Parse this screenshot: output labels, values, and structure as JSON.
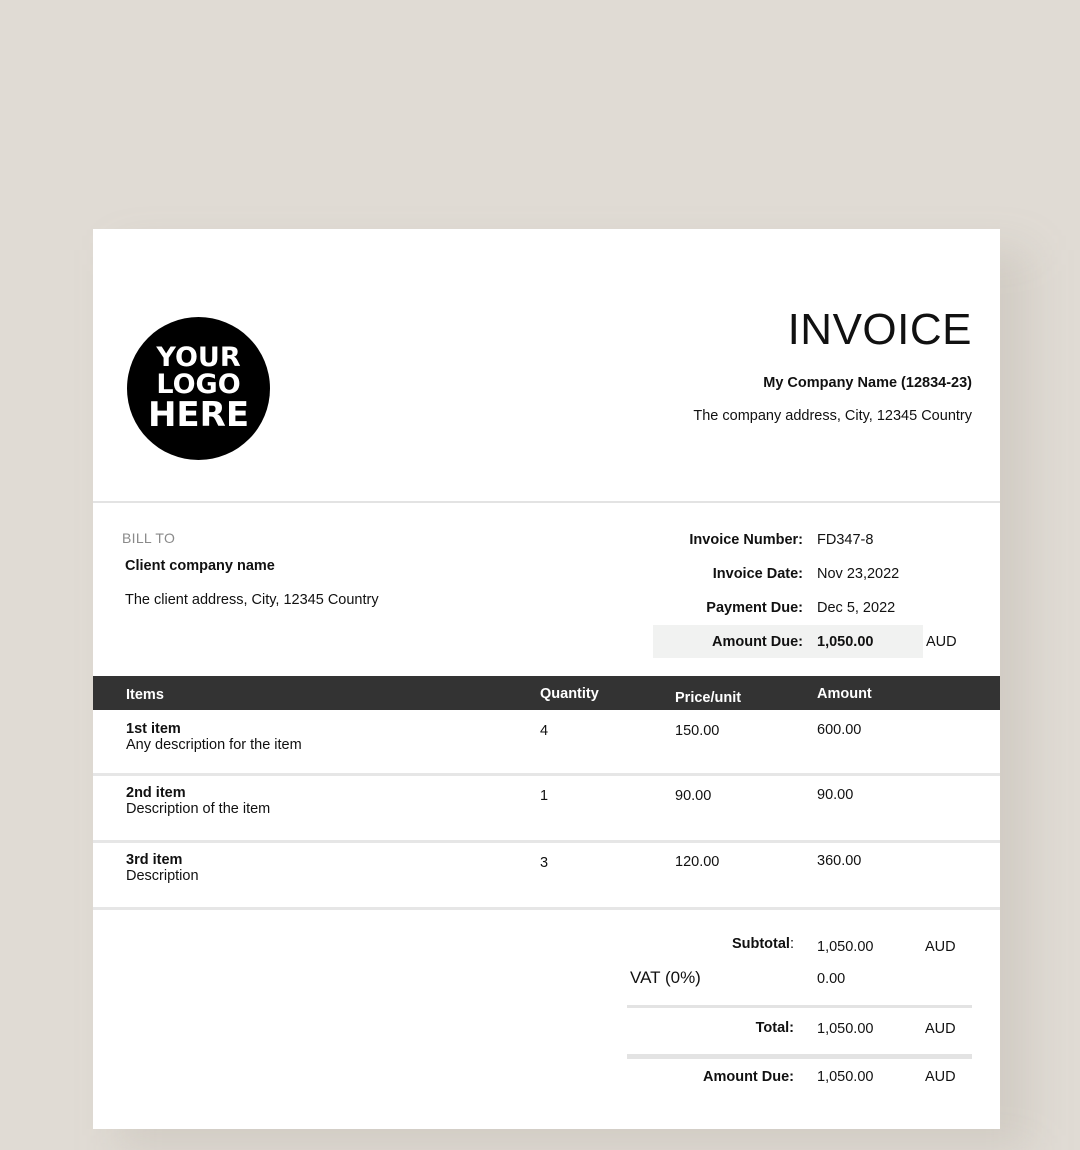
{
  "company": {
    "logo_line1": "YOUR",
    "logo_line2": "LOGO",
    "logo_line3": "HERE",
    "title": "INVOICE",
    "name": "My Company Name (12834-23)",
    "address": "The company address, City, 12345 Country"
  },
  "bill_to": {
    "label": "BILL TO",
    "client_name": "Client company name",
    "client_address": "The client address, City, 12345 Country"
  },
  "meta": {
    "invoice_number_label": "Invoice Number:",
    "invoice_number": "FD347-8",
    "invoice_date_label": "Invoice Date:",
    "invoice_date": "Nov 23,2022",
    "payment_due_label": "Payment Due:",
    "payment_due": "Dec 5, 2022",
    "amount_due_label": "Amount Due:",
    "amount_due": "1,050.00",
    "currency": "AUD"
  },
  "table": {
    "headers": {
      "items": "Items",
      "quantity": "Quantity",
      "price": "Price/unit",
      "amount": "Amount"
    },
    "rows": [
      {
        "name": "1st item",
        "description": "Any description for the item",
        "quantity": "4",
        "price": "150.00",
        "amount": "600.00"
      },
      {
        "name": "2nd item",
        "description": "Description of the item",
        "quantity": "1",
        "price": "90.00",
        "amount": "90.00"
      },
      {
        "name": "3rd item",
        "description": "Description",
        "quantity": "3",
        "price": "120.00",
        "amount": "360.00"
      }
    ]
  },
  "totals": {
    "subtotal_label": "Subtotal",
    "subtotal_colon": ":",
    "subtotal": "1,050.00",
    "subtotal_currency": "AUD",
    "vat_label": "VAT (0%)",
    "vat": "0.00",
    "total_label": "Total:",
    "total": "1,050.00",
    "total_currency": "AUD",
    "amount_due_label": "Amount Due:",
    "amount_due": "1,050.00",
    "amount_due_currency": "AUD"
  },
  "colors": {
    "background": "#e0dbd4",
    "paper": "#ffffff",
    "table_header": "#333333",
    "amount_due_highlight": "#f1f2f1"
  }
}
